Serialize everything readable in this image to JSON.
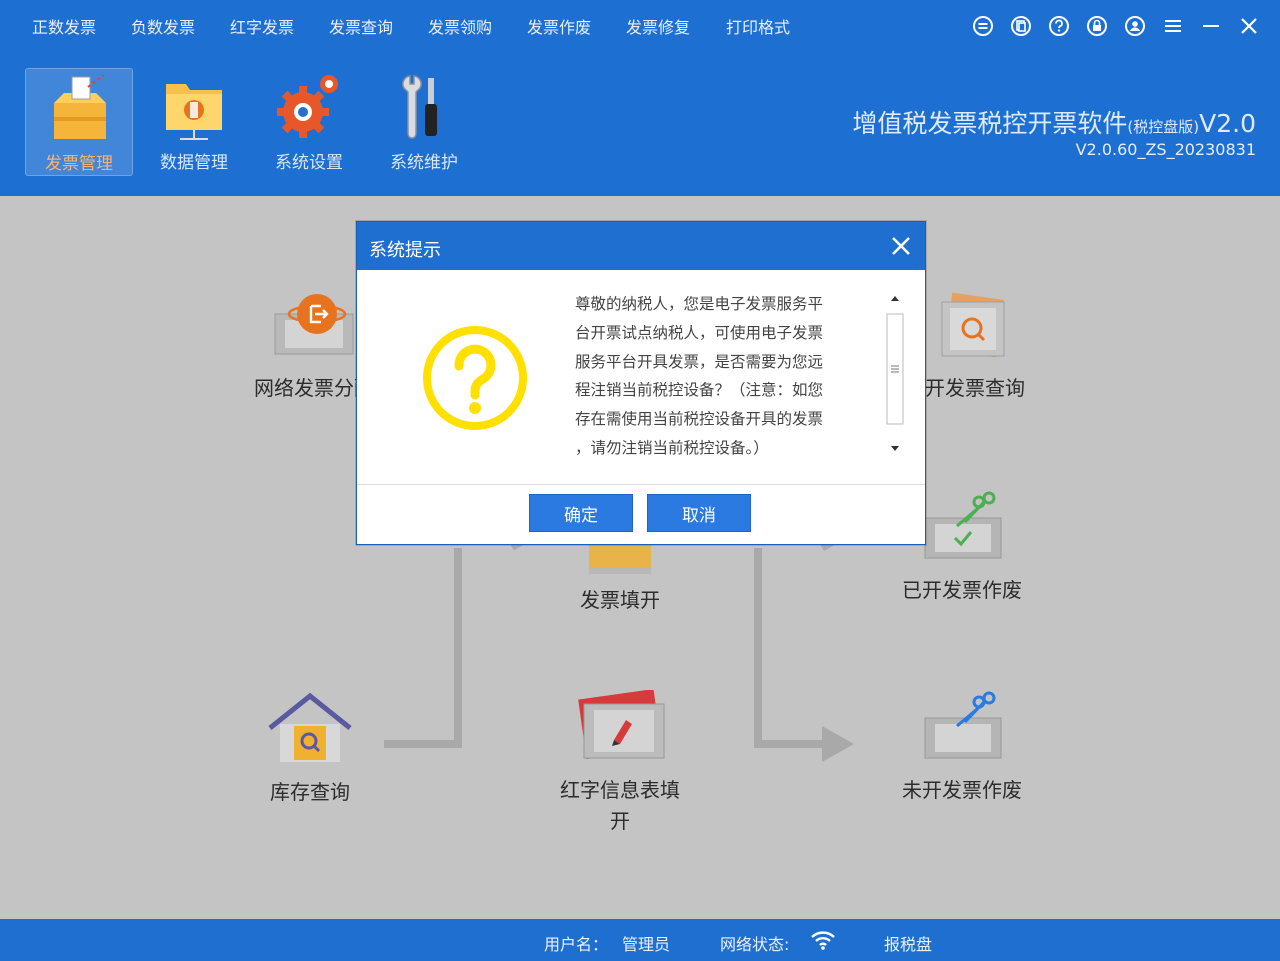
{
  "menu": {
    "items": [
      "正数发票",
      "负数发票",
      "红字发票",
      "发票查询",
      "发票领购",
      "发票作废",
      "发票修复",
      "打印格式"
    ]
  },
  "window_controls": [
    "minus-circle-icon",
    "copy-circle-icon",
    "help-circle-icon",
    "lock-circle-icon",
    "user-circle-icon",
    "hamburger-menu-icon",
    "minimize-icon",
    "close-icon"
  ],
  "toolbar": {
    "items": [
      {
        "label": "发票管理",
        "icon": "invoice-box-icon",
        "active": true
      },
      {
        "label": "数据管理",
        "icon": "data-folder-icon",
        "active": false
      },
      {
        "label": "系统设置",
        "icon": "gear-icon",
        "active": false
      },
      {
        "label": "系统维护",
        "icon": "wrench-screwdriver-icon",
        "active": false
      }
    ]
  },
  "app": {
    "title": "增值税发票税控开票软件",
    "edition": "(税控盘版)",
    "version_suffix": "V2.0",
    "version": "V2.0.60_ZS_20230831"
  },
  "functions": {
    "network_allocation": "网络发票分配",
    "issued_query": "已开发票查询",
    "invoice_fill": "发票填开",
    "issued_void": "已开发票作废",
    "stock_query": "库存查询",
    "red_info_line1": "红字信息表填",
    "red_info_line2": "开",
    "unissued_void": "未开发票作废"
  },
  "dialog": {
    "title": "系统提示",
    "icon": "question-mark-circle-icon",
    "message_lines": [
      "尊敬的纳税人，您是电子发票服务平",
      "台开票试点纳税人，可使用电子发票",
      "服务平台开具发票，是否需要为您远",
      "程注销当前税控设备？（注意：如您",
      "存在需使用当前税控设备开具的发票",
      "，请勿注销当前税控设备。）"
    ],
    "confirm_label": "确定",
    "cancel_label": "取消"
  },
  "status": {
    "user_label": "用户名：",
    "user_value": "管理员",
    "network_label": "网络状态:",
    "tax_label": "报税盘"
  },
  "colors": {
    "header_blue": "#1e6fd2",
    "button_blue": "#2a7ae2",
    "question_yellow": "#ffe000",
    "active_tab_orange": "#ffb26a"
  }
}
